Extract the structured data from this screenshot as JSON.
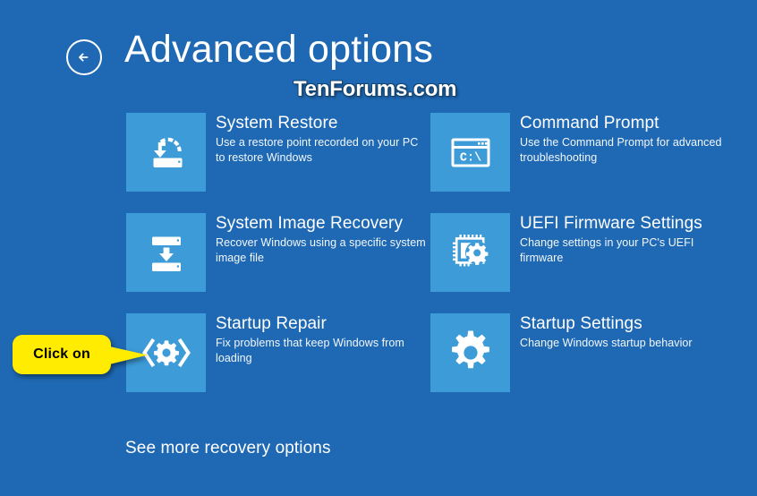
{
  "header": {
    "back_icon": "back-arrow-icon",
    "title": "Advanced options",
    "watermark": "TenForums.com"
  },
  "options": [
    {
      "id": "system-restore",
      "icon": "system-restore-icon",
      "title": "System Restore",
      "description": "Use a restore point recorded on your PC to restore Windows"
    },
    {
      "id": "command-prompt",
      "icon": "command-prompt-icon",
      "title": "Command Prompt",
      "description": "Use the Command Prompt for advanced troubleshooting"
    },
    {
      "id": "system-image-recovery",
      "icon": "system-image-recovery-icon",
      "title": "System Image Recovery",
      "description": "Recover Windows using a specific system image file"
    },
    {
      "id": "uefi-firmware-settings",
      "icon": "uefi-chip-icon",
      "title": "UEFI Firmware Settings",
      "description": "Change settings in your PC's UEFI firmware"
    },
    {
      "id": "startup-repair",
      "icon": "startup-repair-icon",
      "title": "Startup Repair",
      "description": "Fix problems that keep Windows from loading"
    },
    {
      "id": "startup-settings",
      "icon": "gear-icon",
      "title": "Startup Settings",
      "description": "Change Windows startup behavior"
    }
  ],
  "footer": {
    "more_options_label": "See more recovery options"
  },
  "callout": {
    "label": "Click on",
    "target": "startup-repair"
  },
  "colors": {
    "background": "#1f69b4",
    "tile": "#3d9bd8",
    "text": "#ffffff",
    "callout_background": "#ffec00",
    "callout_text": "#000000"
  }
}
